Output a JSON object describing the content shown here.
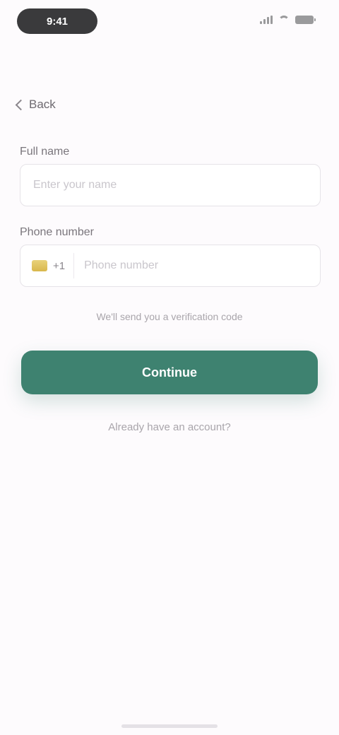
{
  "status_bar": {
    "time": "9:41",
    "icons": [
      "signal-icon",
      "wifi-icon",
      "battery-icon"
    ]
  },
  "nav": {
    "back_label": "Back"
  },
  "form": {
    "name_label": "Full name",
    "name_placeholder": "Enter your name",
    "phone_label": "Phone number",
    "country_code": "+1",
    "phone_placeholder": "Phone number",
    "helper_text": "We'll send you a verification code"
  },
  "actions": {
    "primary_label": "Continue",
    "secondary_label": "Already have an account?"
  },
  "colors": {
    "background": "#fdfbfd",
    "accent": "#3e8270",
    "field_border": "#e6e3e8",
    "muted_text": "#a9a5ab"
  }
}
